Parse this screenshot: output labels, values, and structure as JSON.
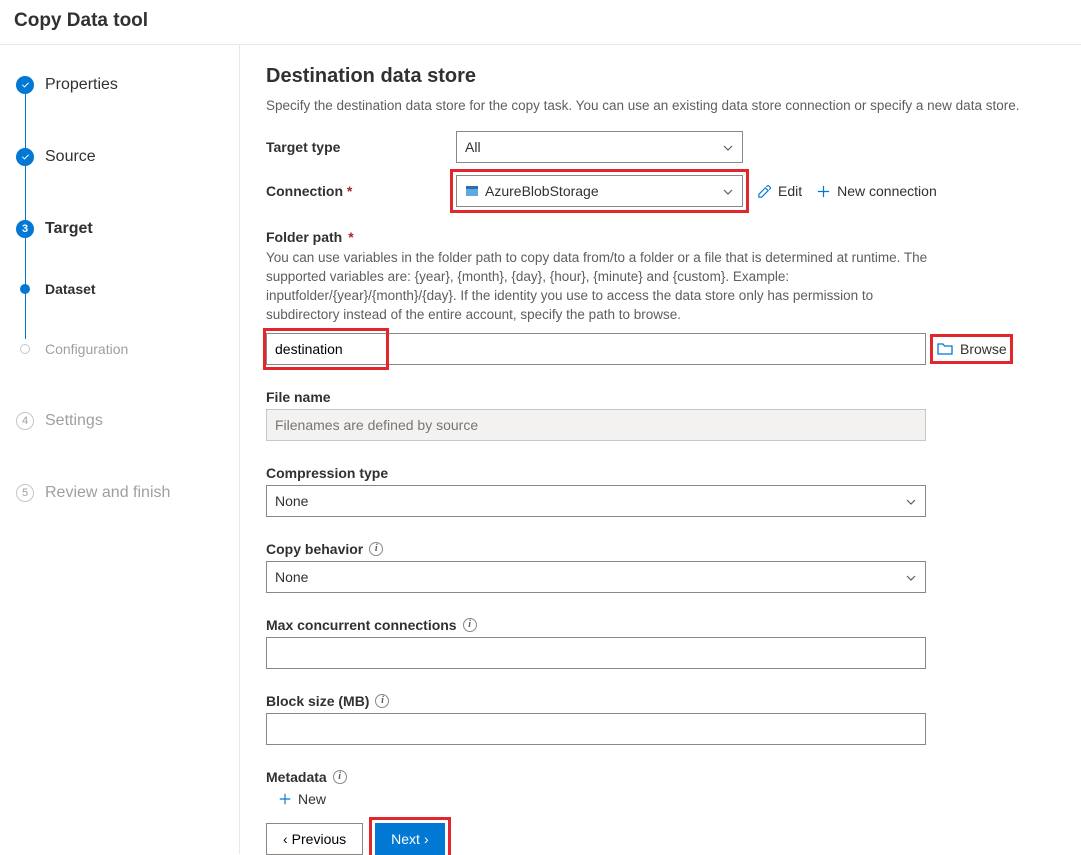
{
  "header": {
    "title": "Copy Data tool"
  },
  "sidebar": {
    "steps": [
      {
        "label": "Properties",
        "state": "done"
      },
      {
        "label": "Source",
        "state": "done"
      },
      {
        "label": "Target",
        "state": "current"
      },
      {
        "label": "Dataset",
        "state": "sub-active"
      },
      {
        "label": "Configuration",
        "state": "sub-todo"
      },
      {
        "label": "Settings",
        "state": "todo",
        "num": "4"
      },
      {
        "label": "Review and finish",
        "state": "todo",
        "num": "5"
      }
    ]
  },
  "main": {
    "title": "Destination data store",
    "description": "Specify the destination data store for the copy task. You can use an existing data store connection or specify a new data store.",
    "target_type": {
      "label": "Target type",
      "value": "All"
    },
    "connection": {
      "label": "Connection",
      "value": "AzureBlobStorage",
      "edit": "Edit",
      "new": "New connection"
    },
    "folder_path": {
      "label": "Folder path",
      "help": "You can use variables in the folder path to copy data from/to a folder or a file that is determined at runtime. The supported variables are: {year}, {month}, {day}, {hour}, {minute} and {custom}. Example: inputfolder/{year}/{month}/{day}. If the identity you use to access the data store only has permission to subdirectory instead of the entire account, specify the path to browse.",
      "value": "destination",
      "browse": "Browse"
    },
    "file_name": {
      "label": "File name",
      "placeholder": "Filenames are defined by source"
    },
    "compression": {
      "label": "Compression type",
      "value": "None"
    },
    "copy_behavior": {
      "label": "Copy behavior",
      "value": "None"
    },
    "max_conn": {
      "label": "Max concurrent connections",
      "value": ""
    },
    "block_size": {
      "label": "Block size (MB)",
      "value": ""
    },
    "metadata": {
      "label": "Metadata",
      "new": "New"
    }
  },
  "footer": {
    "previous": "Previous",
    "next": "Next"
  }
}
